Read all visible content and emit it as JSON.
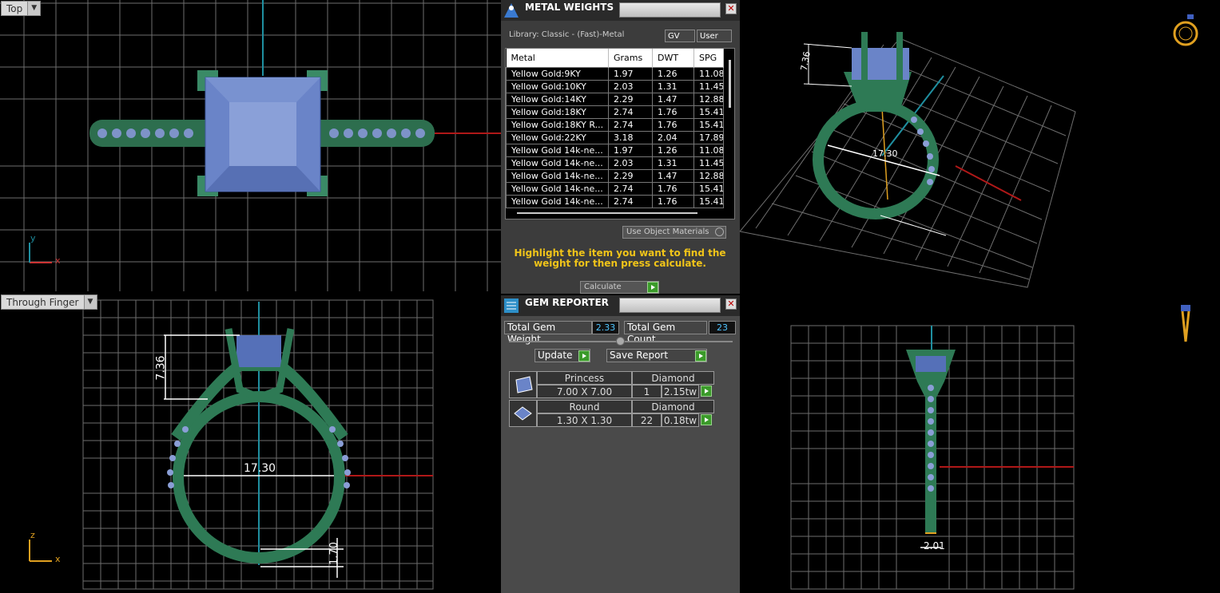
{
  "viewports": {
    "top": {
      "label": "Top",
      "axis_x": "x",
      "axis_y": "y"
    },
    "front": {
      "label": "Through Finger",
      "axis_x": "x",
      "axis_z": "z",
      "dims": {
        "height": "7.36",
        "diameter": "17.30",
        "shank": "1.70"
      }
    },
    "persp": {
      "dims": {
        "height": "7.36",
        "diameter": "17.30"
      }
    },
    "side": {
      "dims": {
        "width": "2.01"
      }
    }
  },
  "metal_weights": {
    "title": "METAL WEIGHTS",
    "library": "Library: Classic - (Fast)-Metal",
    "toggle_gv": "GV",
    "toggle_user": "User",
    "columns": [
      "Metal",
      "Grams",
      "DWT",
      "SPG"
    ],
    "rows": [
      [
        "Yellow Gold:9KY",
        "1.97",
        "1.26",
        "11.08"
      ],
      [
        "Yellow Gold:10KY",
        "2.03",
        "1.31",
        "11.45"
      ],
      [
        "Yellow Gold:14KY",
        "2.29",
        "1.47",
        "12.88"
      ],
      [
        "Yellow Gold:18KY",
        "2.74",
        "1.76",
        "15.41"
      ],
      [
        "Yellow Gold:18KY R...",
        "2.74",
        "1.76",
        "15.41"
      ],
      [
        "Yellow Gold:22KY",
        "3.18",
        "2.04",
        "17.89"
      ],
      [
        "Yellow Gold 14k-ne...",
        "1.97",
        "1.26",
        "11.08"
      ],
      [
        "Yellow Gold 14k-ne...",
        "2.03",
        "1.31",
        "11.45"
      ],
      [
        "Yellow Gold 14k-ne...",
        "2.29",
        "1.47",
        "12.88"
      ],
      [
        "Yellow Gold 14k-ne...",
        "2.74",
        "1.76",
        "15.41"
      ],
      [
        "Yellow Gold 14k-ne...",
        "2.74",
        "1.76",
        "15.41"
      ]
    ],
    "use_object_materials": "Use Object Materials",
    "hint": "Highlight the item you want to find the weight for then press calculate.",
    "calculate": "Calculate"
  },
  "gem_reporter": {
    "title": "GEM REPORTER",
    "total_weight_label": "Total Gem Weight",
    "total_weight": "2.33",
    "total_count_label": "Total Gem Count",
    "total_count": "23",
    "update": "Update",
    "save_report": "Save Report",
    "gems": [
      {
        "shape": "Princess",
        "size": "7.00 X 7.00",
        "type": "Diamond",
        "count": "1",
        "weight": "2.15tw"
      },
      {
        "shape": "Round",
        "size": "1.30 X 1.30",
        "type": "Diamond",
        "count": "22",
        "weight": "0.18tw"
      }
    ]
  },
  "colors": {
    "ring": "#2e7a55",
    "stone": "#6a84c8",
    "grid": "#808080",
    "hint": "#f0c419",
    "value": "#4fc4ff"
  }
}
